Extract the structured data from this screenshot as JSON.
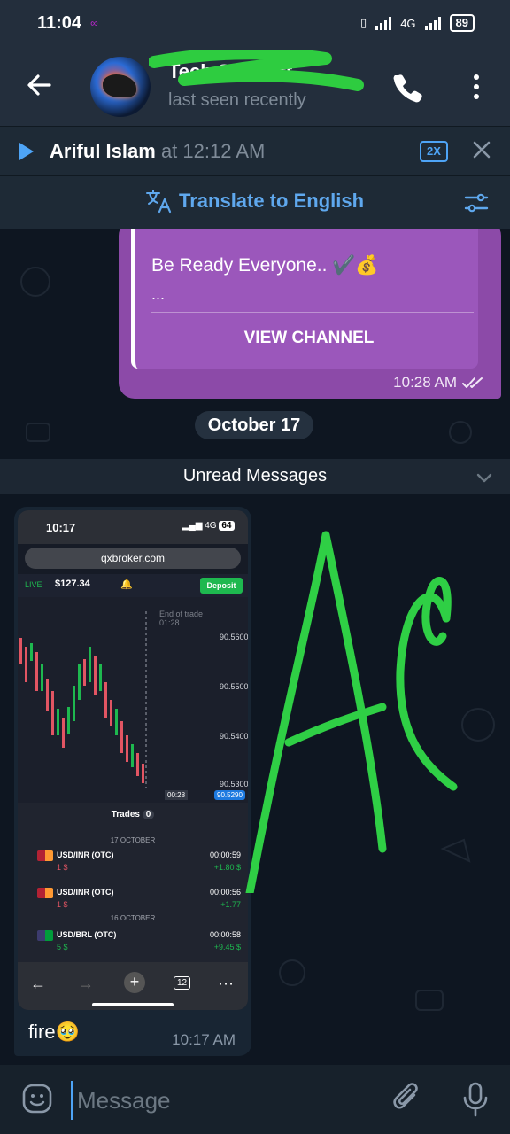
{
  "status": {
    "time": "11:04",
    "network": "4G",
    "battery": "89"
  },
  "header": {
    "title": "Tech Support",
    "subtitle": "last seen recently"
  },
  "pinned": {
    "name": "Ariful Islam",
    "time": "at 12:12 AM",
    "speed": "2X"
  },
  "translate": {
    "label": "Translate to English"
  },
  "outgoing": {
    "text": "Be Ready Everyone.. ✔️💰",
    "ellipsis": "...",
    "button": "VIEW CHANNEL",
    "time": "10:28 AM"
  },
  "date_divider": "October 17",
  "unread_label": "Unread Messages",
  "incoming": {
    "caption": "fire🥹",
    "time": "10:17 AM",
    "screenshot": {
      "time": "10:17",
      "network": "4G",
      "battery": "64",
      "url": "qxbroker.com",
      "live": "LIVE",
      "balance": "$127.34",
      "deposit": "Deposit",
      "end_trade": "End of trade",
      "end_trade_time": "01:28",
      "prices": [
        "90.5600",
        "90.5500",
        "90.5400",
        "90.5300"
      ],
      "current_price": "90.5290",
      "timer": "00:28",
      "trades_label": "Trades",
      "trades_count": "0",
      "section1": "17 OCTOBER",
      "section2": "16 OCTOBER",
      "tab_count": "12",
      "trades": [
        {
          "pair": "USD/INR (OTC)",
          "amount": "1 $",
          "duration": "00:00:59",
          "pnl": "+1.80 $"
        },
        {
          "pair": "USD/INR (OTC)",
          "amount": "1 $",
          "duration": "00:00:56",
          "pnl": "+1.77"
        },
        {
          "pair": "USD/BRL (OTC)",
          "amount": "5 $",
          "duration": "00:00:58",
          "pnl": "+9.45 $"
        }
      ]
    }
  },
  "composer": {
    "placeholder": "Message"
  },
  "colors": {
    "accent": "#4ea4f6",
    "bubble_out": "#8c4aa8",
    "chat_bg": "#0e1621",
    "header_bg": "#232e3c",
    "scribble": "#2ecc40",
    "drawing": "#2fcf45"
  },
  "icons": {
    "back": "arrow-left-icon",
    "call": "phone-icon",
    "menu": "more-vertical-icon",
    "play": "play-icon",
    "close": "close-icon",
    "translate": "translate-icon",
    "filter": "filter-icon",
    "chevron": "chevron-down-icon",
    "emoji": "emoji-icon",
    "attach": "paperclip-icon",
    "mic": "mic-icon"
  }
}
